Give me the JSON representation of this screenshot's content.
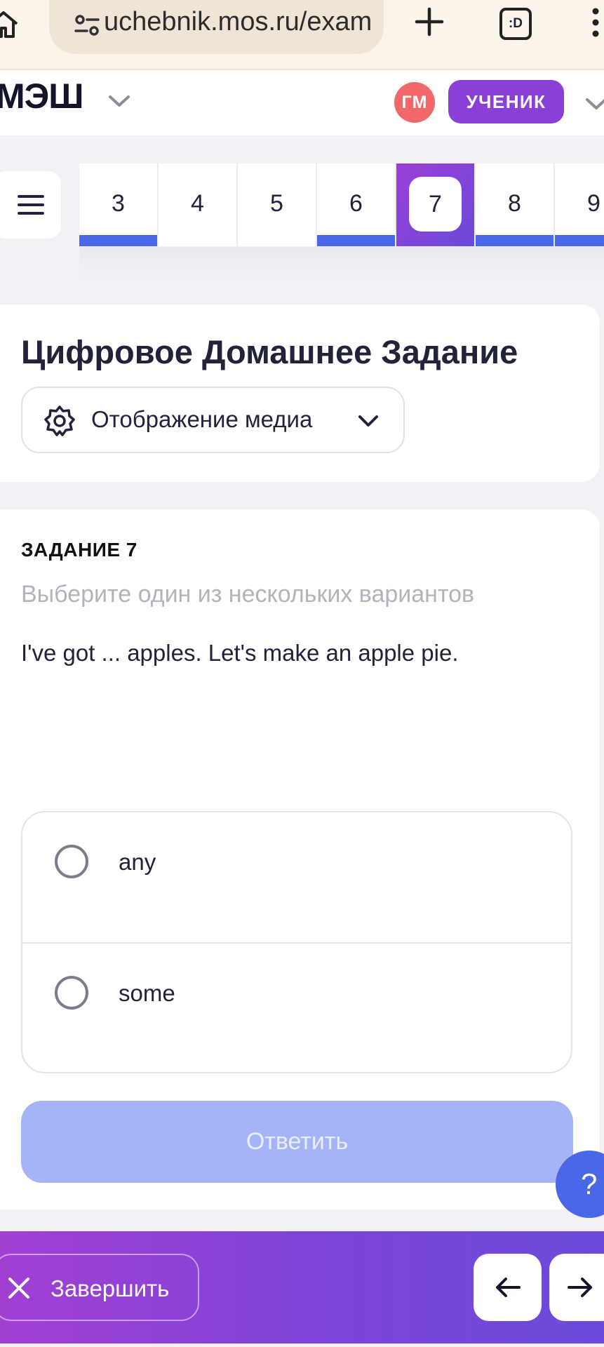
{
  "browser": {
    "url": "uchebnik.mos.ru/exam"
  },
  "header": {
    "logo": "МЭШ",
    "avatar_initials": "ГМ",
    "role_label": "УЧЕНИК"
  },
  "task_nav": {
    "items": [
      {
        "label": "3",
        "state": "done"
      },
      {
        "label": "4",
        "state": "pending"
      },
      {
        "label": "5",
        "state": "pending"
      },
      {
        "label": "6",
        "state": "done"
      },
      {
        "label": "7",
        "state": "active"
      },
      {
        "label": "8",
        "state": "done"
      },
      {
        "label": "9",
        "state": "done"
      }
    ]
  },
  "title_card": {
    "title": "Цифровое Домашнее Задание",
    "media_dropdown_label": "Отображение медиа"
  },
  "task": {
    "label": "ЗАДАНИЕ 7",
    "instruction": "Выберите один из нескольких вариантов",
    "question": "I've got ... apples. Let's make an apple pie.",
    "options": [
      {
        "label": "any",
        "selected": false
      },
      {
        "label": "some",
        "selected": false
      }
    ],
    "answer_button_label": "Ответить"
  },
  "help": {
    "label": "?"
  },
  "bottom_bar": {
    "finish_label": "Завершить"
  },
  "colors": {
    "accent_purple": "#8a3fd6",
    "accent_blue": "#4a67e8",
    "avatar_red": "#f2686a",
    "answer_disabled": "#a5b4f7"
  }
}
